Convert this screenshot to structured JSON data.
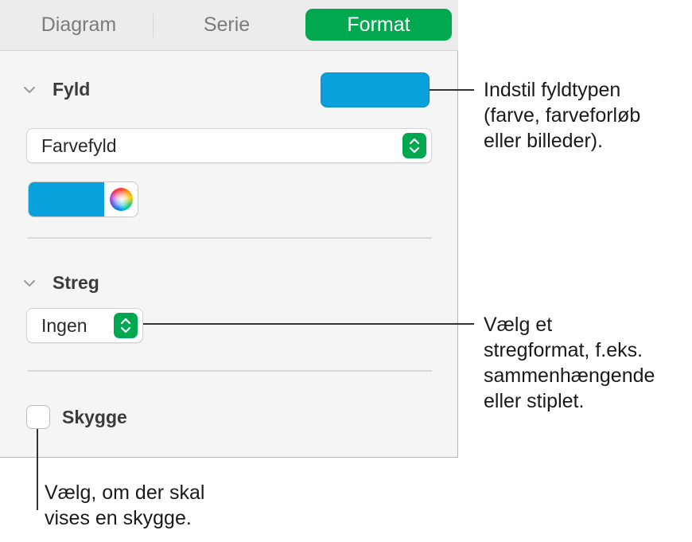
{
  "tabs": [
    {
      "label": "Diagram",
      "selected": false
    },
    {
      "label": "Serie",
      "selected": false
    },
    {
      "label": "Format",
      "selected": true
    }
  ],
  "fill": {
    "title": "Fyld",
    "swatch_color": "#0aa0dc",
    "type_value": "Farvefyld",
    "well_color": "#0aa0dc"
  },
  "stroke": {
    "title": "Streg",
    "type_value": "Ingen"
  },
  "shadow": {
    "label": "Skygge",
    "checked": false
  },
  "callouts": {
    "fill": [
      "Indstil fyldtypen",
      "(farve, farveforløb",
      "eller billeder)."
    ],
    "stroke": [
      "Vælg et",
      "stregformat, f.eks.",
      "sammenhængende",
      "eller stiplet."
    ],
    "shadow": [
      "Vælg, om der skal",
      "vises en skygge."
    ]
  },
  "colors": {
    "accent": "#00a84f",
    "fill_blue": "#0aa0dc"
  }
}
